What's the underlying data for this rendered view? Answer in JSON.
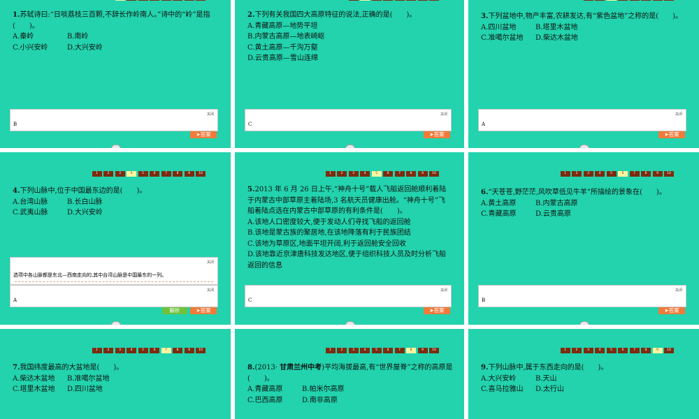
{
  "nav_pages": [
    "1",
    "2",
    "3",
    "4",
    "5",
    "6",
    "7",
    "8",
    "9",
    "10"
  ],
  "close_label": "关闭",
  "answer_label": "➤答案",
  "explain_label": "解析",
  "slides": [
    {
      "num": "1.",
      "text": "苏轼诗曰:“日啖荔枝三百颗,不辞长作岭南人。”诗中的“岭”是指(　　)。",
      "options": [
        "A.秦岭",
        "B.南岭",
        "C.小兴安岭",
        "D.大兴安岭"
      ],
      "answer": "B"
    },
    {
      "num": "2.",
      "text": "下列有关我国四大高原特征的说法,正确的是(　　)。",
      "options": [
        "A.青藏高原—地势平坦",
        "B.内蒙古高原—地表崎岖",
        "C.黄土高原—千沟万壑",
        "D.云贵高原—雪山连绵"
      ],
      "answer": "C"
    },
    {
      "num": "3.",
      "text": "下列盆地中,物产丰富,农耕发达,有“紫色盆地”之称的是(　　)。",
      "options": [
        "A.四川盆地",
        "B.塔里木盆地",
        "C.准噶尔盆地",
        "D.柴达木盆地"
      ],
      "answer": "A"
    },
    {
      "num": "4.",
      "text": "下列山脉中,位于中国最东边的是(　　)。",
      "options": [
        "A.台湾山脉",
        "B.长白山脉",
        "C.武夷山脉",
        "D.大兴安岭"
      ],
      "answer": "A",
      "explanation": "选项中各山脉都是东北—西南走向的,其中台湾山脉是中国最东的一列。"
    },
    {
      "num": "5.",
      "text": "2013 年 6 月 26 日上午,“神舟十号”载人飞船返回舱顺利着陆于内蒙古中部草原主着陆场,3 名航天员健康出舱。“神舟十号”飞船着陆点选在内蒙古中部草原的有利条件是(　　)。",
      "options_full": [
        "A.该地人口密度较大,便于发动人们寻找飞船的返回舱",
        "B.该地是蒙古族的聚居地,在该地降落有利于民族团结",
        "C.该地为草原区,地面平坦开阔,利于返回舱安全回收",
        "D.该地靠近京津唐科技发达地区,便于组织科技人员及时分析飞船返回的信息"
      ],
      "answer": "C"
    },
    {
      "num": "6.",
      "text": "“天苍苍,野茫茫,风吹草低见牛羊”所描绘的景象在(　　)。",
      "options": [
        "A.黄土高原",
        "B.内蒙古高原",
        "C.青藏高原",
        "D.云贵高原"
      ],
      "answer": "B"
    },
    {
      "num": "7.",
      "text": "我国纬度最高的大盆地是(　　)。",
      "options": [
        "A.柴达木盆地",
        "B.准噶尔盆地",
        "C.塔里木盆地",
        "D.四川盆地"
      ]
    },
    {
      "num": "8.",
      "text_pre": "(2013· ",
      "text_bold": "甘肃兰州中考",
      "text": ")平均海拔最高,有“世界屋脊”之称的高原是(　　)。",
      "options": [
        "A.青藏高原",
        "B.帕米尔高原",
        "C.巴西高原",
        "D.南非高原"
      ]
    },
    {
      "num": "9.",
      "text": "下列山脉中,属于东西走向的是(　　)。",
      "options": [
        "A.大兴安岭",
        "B.天山",
        "C.喜马拉雅山",
        "D.太行山"
      ]
    }
  ]
}
